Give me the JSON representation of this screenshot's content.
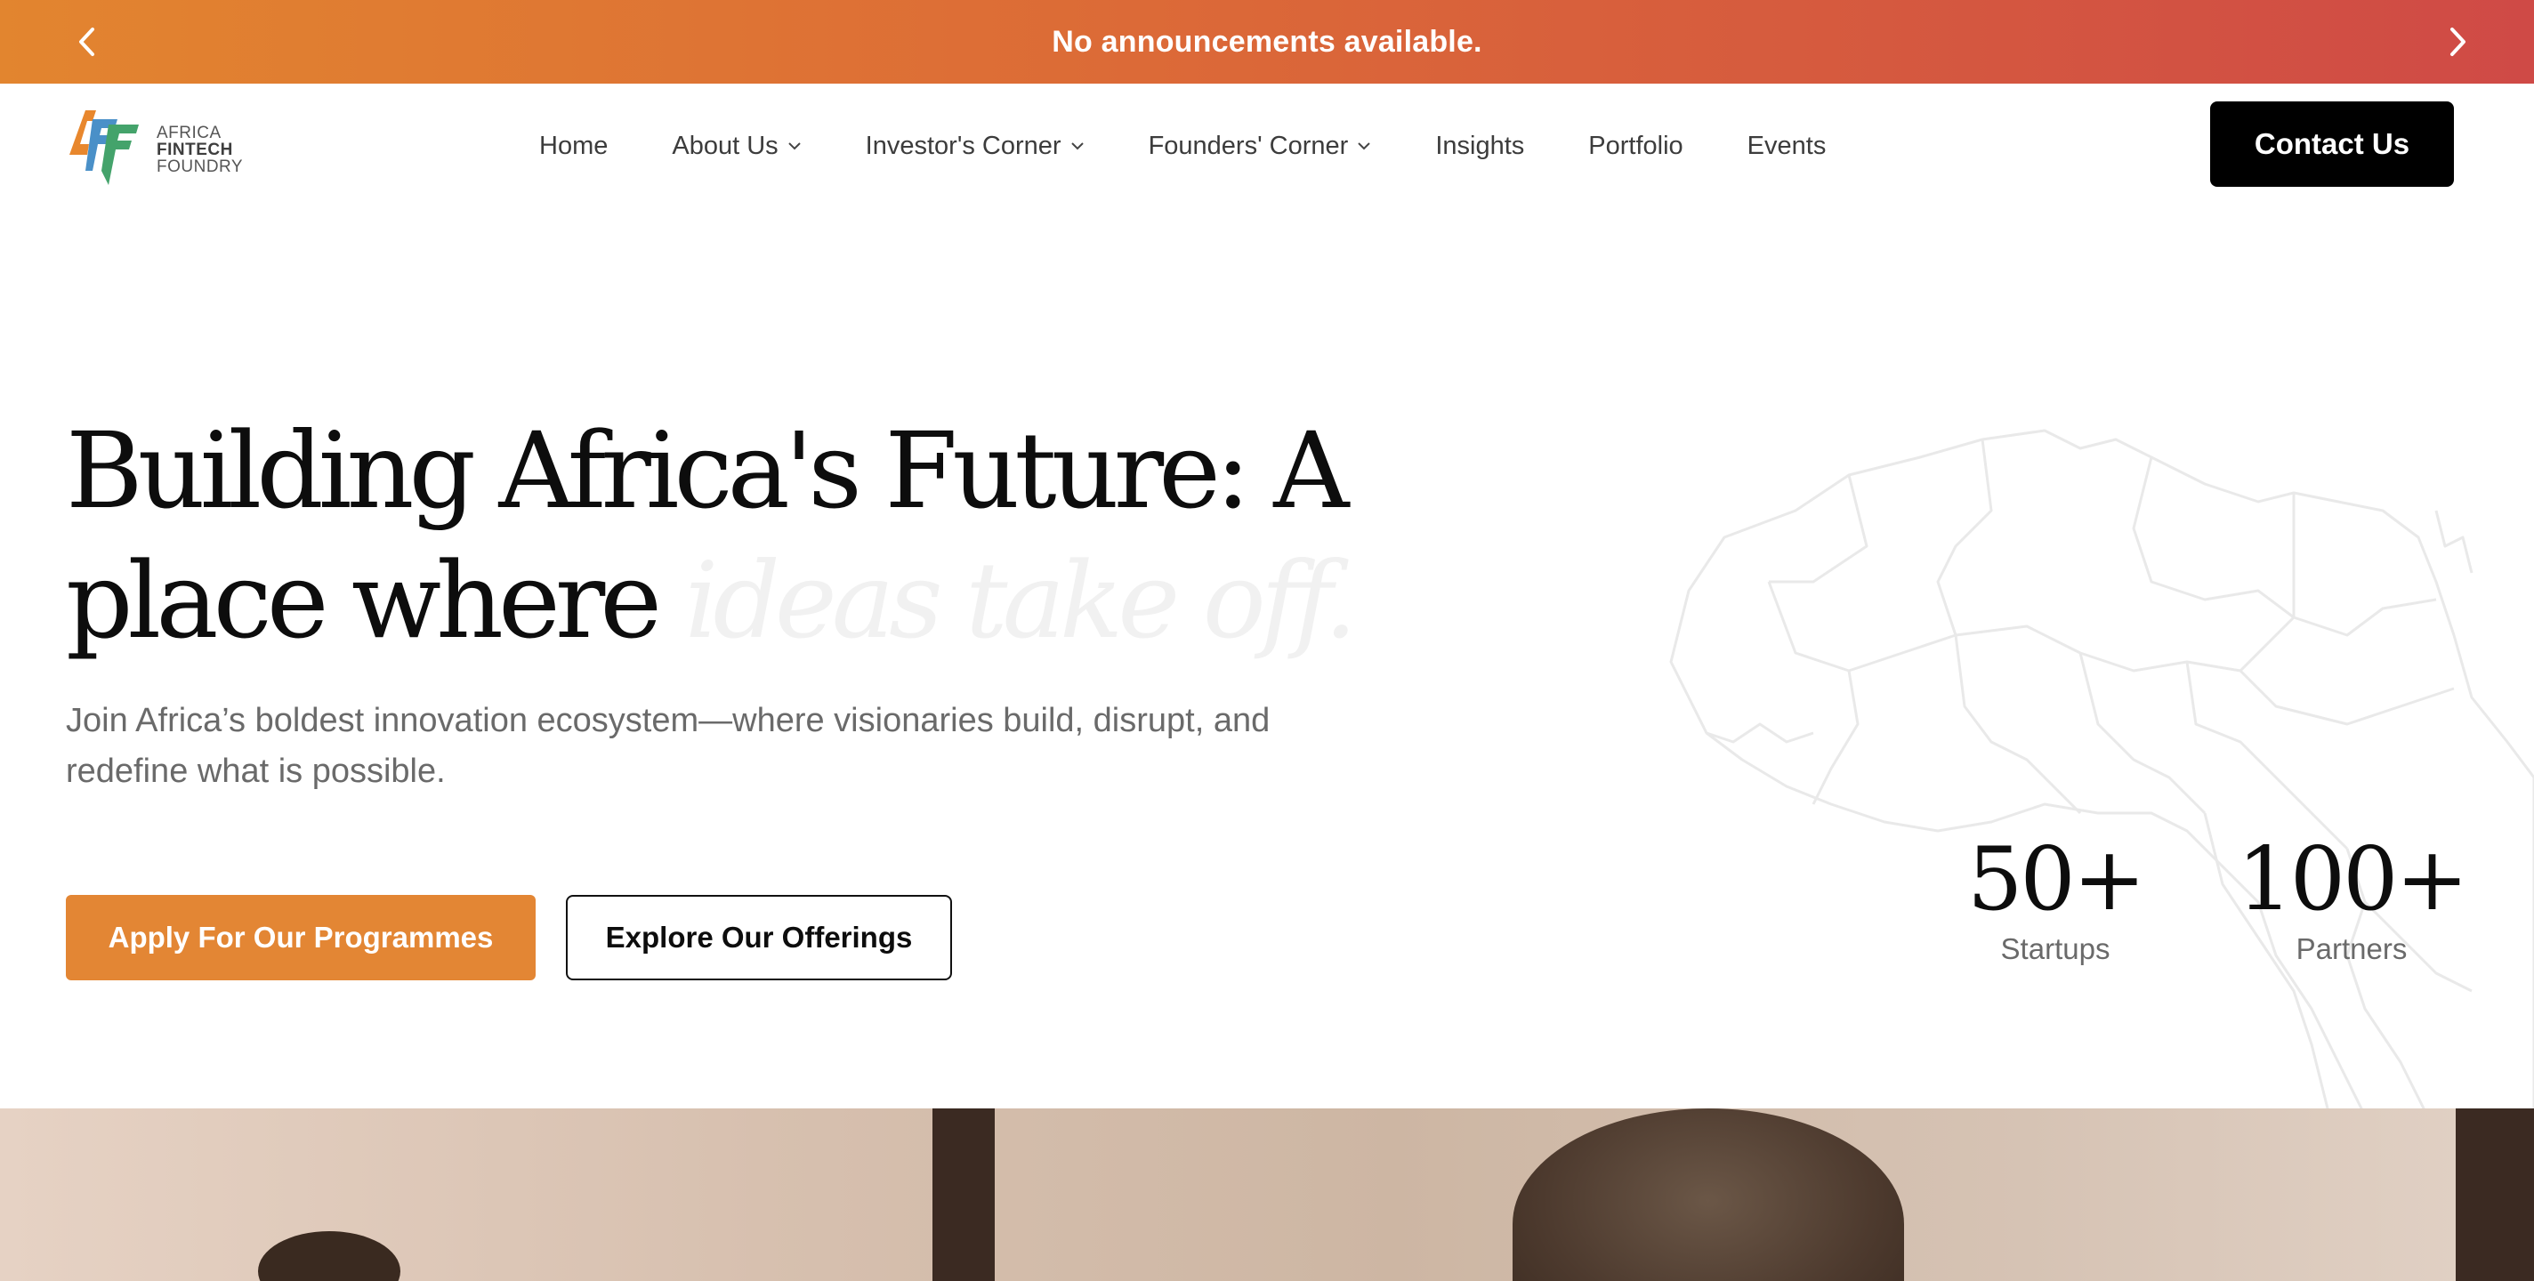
{
  "announcement": {
    "text": "No announcements available.",
    "prev_icon": "chevron-left-icon",
    "next_icon": "chevron-right-icon"
  },
  "header": {
    "logo": {
      "line1": "AFRICA",
      "line2": "FINTECH",
      "line3": "FOUNDRY"
    },
    "nav": [
      {
        "label": "Home",
        "dropdown": false
      },
      {
        "label": "About Us",
        "dropdown": true
      },
      {
        "label": "Investor's Corner",
        "dropdown": true
      },
      {
        "label": "Founders' Corner",
        "dropdown": true
      },
      {
        "label": "Insights",
        "dropdown": false
      },
      {
        "label": "Portfolio",
        "dropdown": false
      },
      {
        "label": "Events",
        "dropdown": false
      }
    ],
    "contact_label": "Contact Us"
  },
  "hero": {
    "headline_main": "Building Africa's Future: A place where",
    "headline_faded": "ideas take off.",
    "subtext": "Join Africa’s boldest innovation ecosystem—where visionaries build, disrupt, and redefine what is possible.",
    "apply_label": "Apply For Our Programmes",
    "explore_label": "Explore Our Offerings",
    "stats": [
      {
        "value": "50+",
        "label": "Startups"
      },
      {
        "value": "100+",
        "label": "Partners"
      }
    ]
  },
  "colors": {
    "announce_start": "#e2852f",
    "announce_end": "#cf4a46",
    "accent_orange": "#e38634",
    "black": "#000000"
  }
}
